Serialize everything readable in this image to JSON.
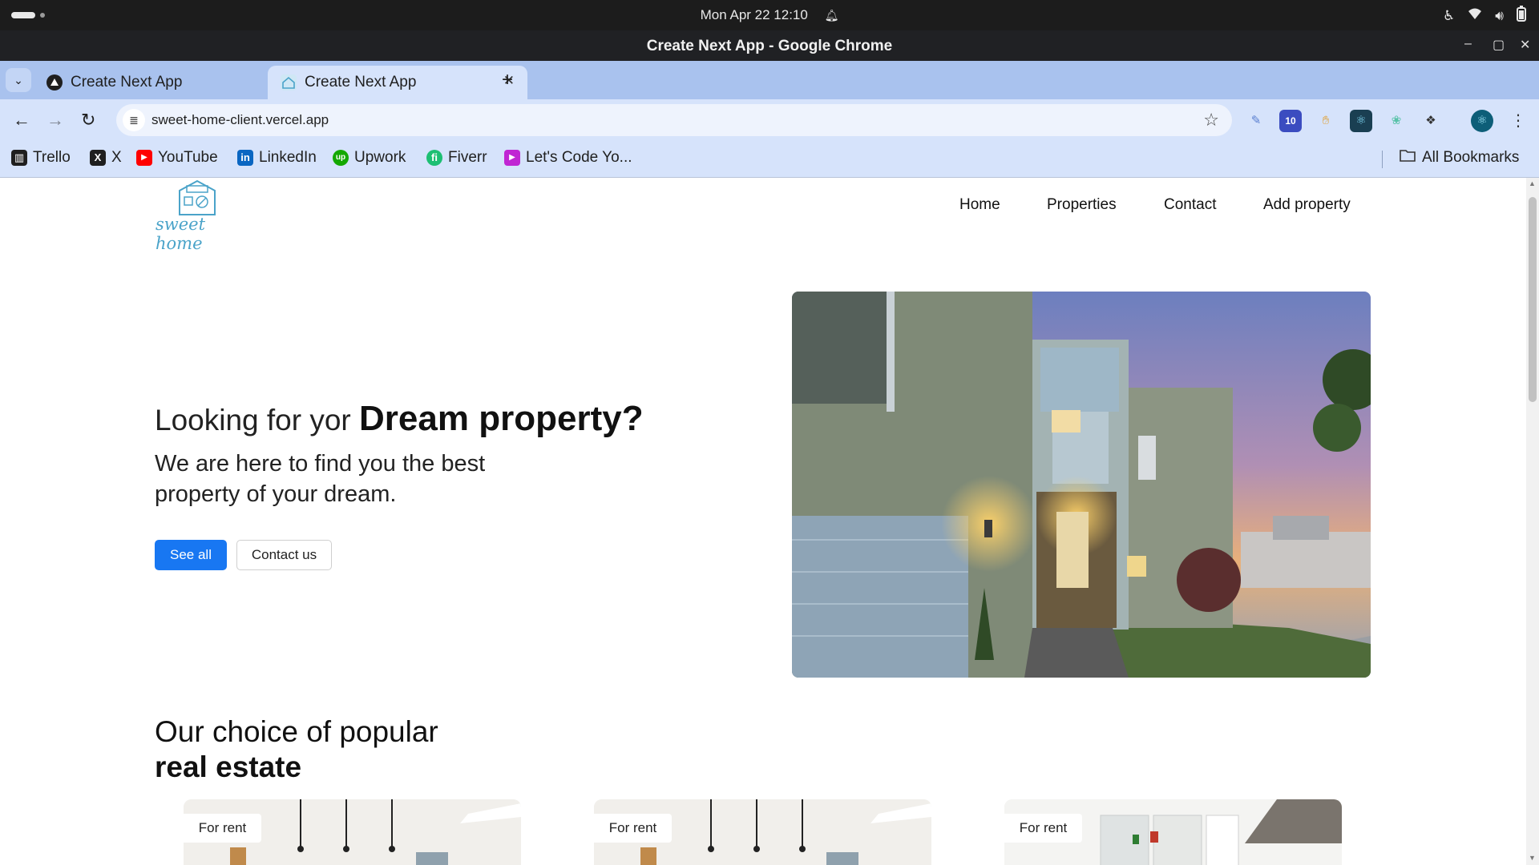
{
  "os": {
    "clock": "Mon Apr 22  12:10"
  },
  "window": {
    "title": "Create Next App - Google Chrome"
  },
  "tabs": [
    {
      "label": "Create Next App",
      "active": false,
      "favicon": "triangle-icon"
    },
    {
      "label": "Create Next App",
      "active": true,
      "favicon": "house-icon"
    }
  ],
  "toolbar": {
    "url": "sweet-home-client.vercel.app",
    "extension_badge": "10"
  },
  "bookmarks": {
    "items": [
      {
        "label": "Trello",
        "icon": "trello-icon",
        "color": "#1f1f1f"
      },
      {
        "label": "X",
        "icon": "x-icon",
        "color": "#1f1f1f"
      },
      {
        "label": "YouTube",
        "icon": "youtube-icon",
        "color": "#ff0000"
      },
      {
        "label": "LinkedIn",
        "icon": "linkedin-icon",
        "color": "#0a66c2"
      },
      {
        "label": "Upwork",
        "icon": "upwork-icon",
        "color": "#14a800"
      },
      {
        "label": "Fiverr",
        "icon": "fiverr-icon",
        "color": "#1dbf73"
      },
      {
        "label": "Let's Code Yo...",
        "icon": "code-icon",
        "color": "#c026d3"
      }
    ],
    "all_label": "All Bookmarks"
  },
  "site": {
    "logo_text": "sweet home",
    "nav": [
      "Home",
      "Properties",
      "Contact",
      "Add property"
    ],
    "hero": {
      "title_prefix": "Looking for yor",
      "title_bold": "Dream property?",
      "subtitle": "We are here to find you the best property of your dream.",
      "primary_button": "See all",
      "secondary_button": "Contact us"
    },
    "section": {
      "title_line1": "Our choice of popular",
      "title_line2": "real estate"
    },
    "cards": [
      {
        "badge": "For rent"
      },
      {
        "badge": "For rent"
      },
      {
        "badge": "For rent"
      }
    ]
  },
  "colors": {
    "primary_button": "#1877f2",
    "tabstrip": "#a9c2ee",
    "toolbar": "#d6e3fb"
  }
}
